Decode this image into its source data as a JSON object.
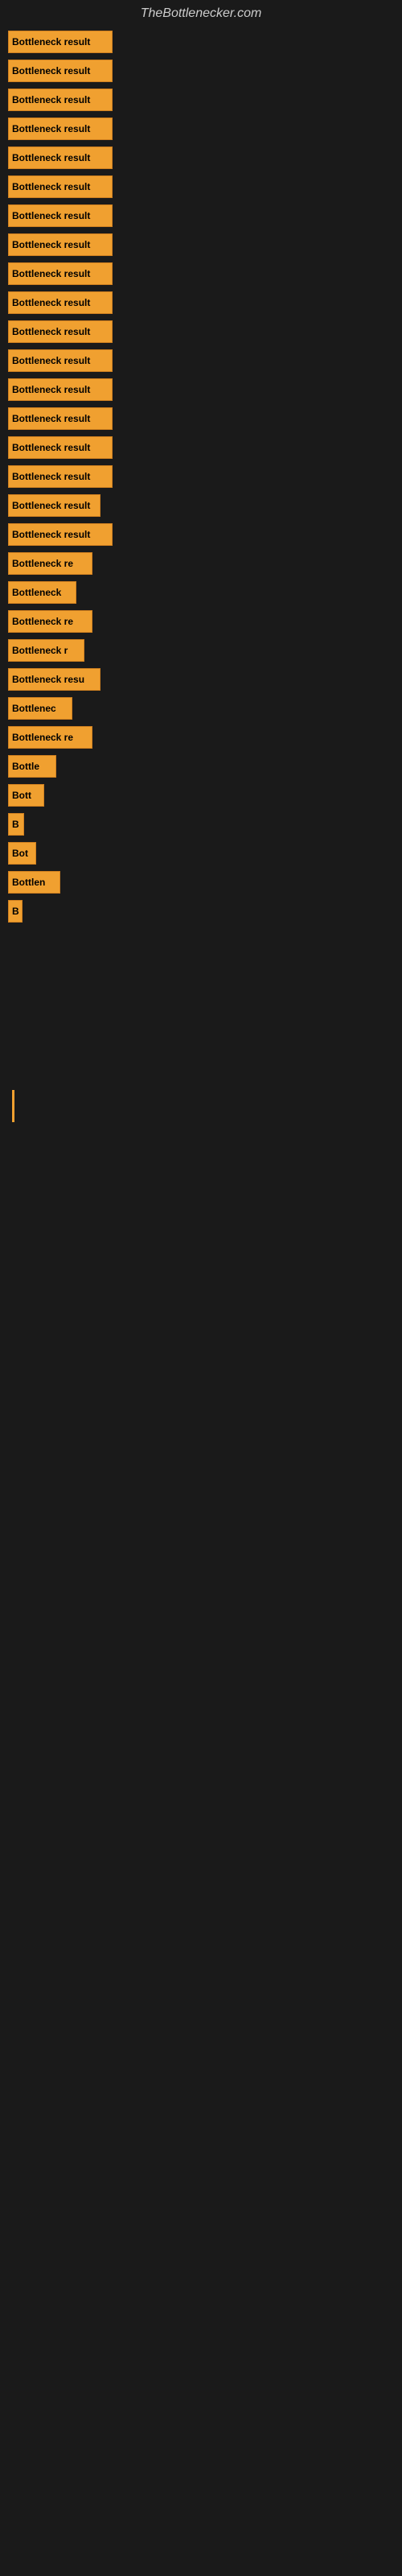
{
  "site": {
    "title": "TheBottlenecker.com"
  },
  "bars": [
    {
      "label": "Bottleneck result",
      "width": 130
    },
    {
      "label": "Bottleneck result",
      "width": 130
    },
    {
      "label": "Bottleneck result",
      "width": 130
    },
    {
      "label": "Bottleneck result",
      "width": 130
    },
    {
      "label": "Bottleneck result",
      "width": 130
    },
    {
      "label": "Bottleneck result",
      "width": 130
    },
    {
      "label": "Bottleneck result",
      "width": 130
    },
    {
      "label": "Bottleneck result",
      "width": 130
    },
    {
      "label": "Bottleneck result",
      "width": 130
    },
    {
      "label": "Bottleneck result",
      "width": 130
    },
    {
      "label": "Bottleneck result",
      "width": 130
    },
    {
      "label": "Bottleneck result",
      "width": 130
    },
    {
      "label": "Bottleneck result",
      "width": 130
    },
    {
      "label": "Bottleneck result",
      "width": 130
    },
    {
      "label": "Bottleneck result",
      "width": 130
    },
    {
      "label": "Bottleneck result",
      "width": 130
    },
    {
      "label": "Bottleneck result",
      "width": 115
    },
    {
      "label": "Bottleneck result",
      "width": 130
    },
    {
      "label": "Bottleneck re",
      "width": 105
    },
    {
      "label": "Bottleneck",
      "width": 85
    },
    {
      "label": "Bottleneck re",
      "width": 105
    },
    {
      "label": "Bottleneck r",
      "width": 95
    },
    {
      "label": "Bottleneck resu",
      "width": 115
    },
    {
      "label": "Bottlenec",
      "width": 80
    },
    {
      "label": "Bottleneck re",
      "width": 105
    },
    {
      "label": "Bottle",
      "width": 60
    },
    {
      "label": "Bott",
      "width": 45
    },
    {
      "label": "B",
      "width": 20
    },
    {
      "label": "Bot",
      "width": 35
    },
    {
      "label": "Bottlen",
      "width": 65
    },
    {
      "label": "B",
      "width": 18
    }
  ],
  "colors": {
    "bar_fill": "#f0a030",
    "bar_border": "#d08020",
    "background": "#1a1a1a",
    "text": "#cccccc",
    "bar_text": "#000000"
  }
}
